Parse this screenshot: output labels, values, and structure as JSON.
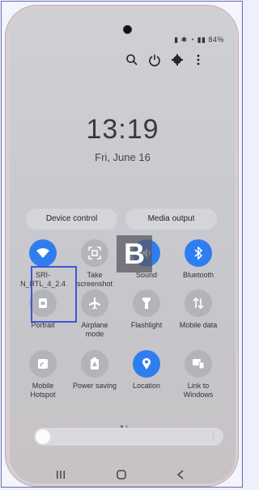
{
  "status_bar": {
    "battery": "84%"
  },
  "top_icons": [
    "search-icon",
    "power-icon",
    "gear-icon",
    "more-vert-icon"
  ],
  "clock": {
    "time": "13:19",
    "date": "Fri, June 16"
  },
  "pills": {
    "device_control": "Device control",
    "media_output": "Media output"
  },
  "tiles": [
    {
      "label": "SRI-N_RTL_4_2.4",
      "icon": "wifi-icon",
      "active": true
    },
    {
      "label": "Take screenshot",
      "icon": "screenshot-icon",
      "active": false
    },
    {
      "label": "Sound",
      "icon": "sound-icon",
      "active": true
    },
    {
      "label": "Bluetooth",
      "icon": "bluetooth-icon",
      "active": true
    },
    {
      "label": "Portrait",
      "icon": "lock-rotation-icon",
      "active": false
    },
    {
      "label": "Airplane mode",
      "icon": "airplane-icon",
      "active": false
    },
    {
      "label": "Flashlight",
      "icon": "flashlight-icon",
      "active": false
    },
    {
      "label": "Mobile data",
      "icon": "data-arrows-icon",
      "active": false
    },
    {
      "label": "Mobile Hotspot",
      "icon": "hotspot-icon",
      "active": false
    },
    {
      "label": "Power saving",
      "icon": "battery-leaf-icon",
      "active": false
    },
    {
      "label": "Location",
      "icon": "location-icon",
      "active": true
    },
    {
      "label": "Link to Windows",
      "icon": "link-windows-icon",
      "active": false
    }
  ],
  "colors": {
    "accent": "#2f7ef0",
    "inactive": "#b3b4b9",
    "highlight": "#3e56d3"
  },
  "brightness": {
    "level": 0.02
  },
  "watermark": "B"
}
